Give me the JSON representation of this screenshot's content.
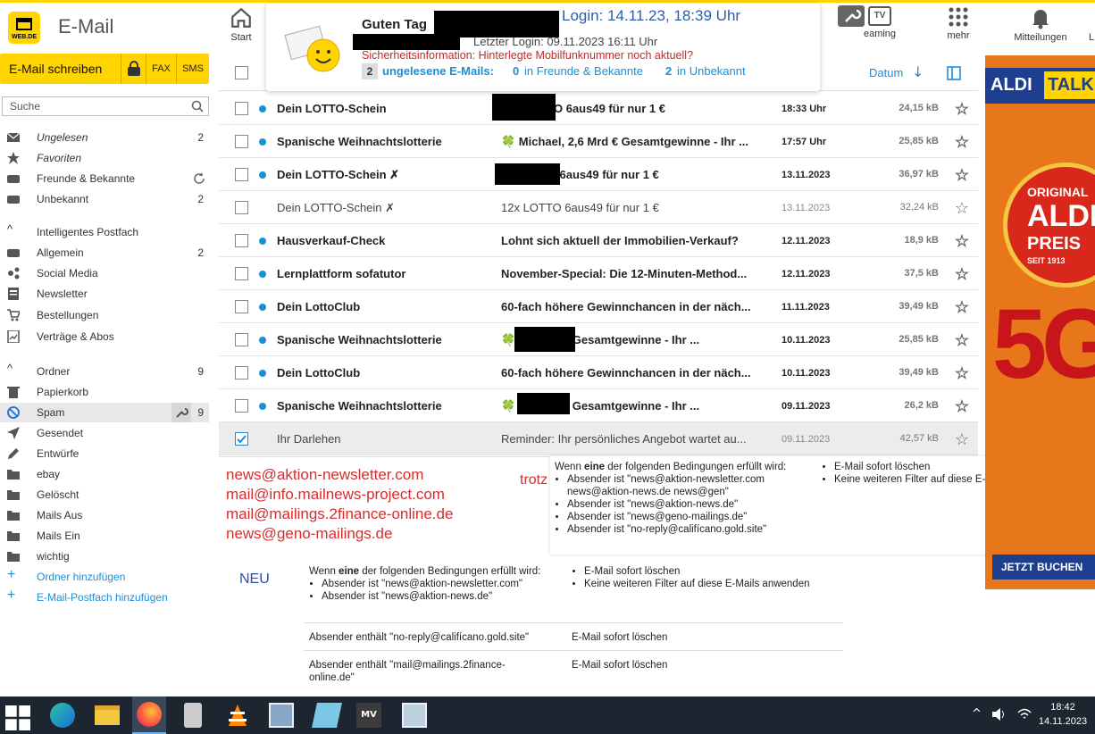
{
  "app": {
    "logo_text": "WEB.DE",
    "title": "E-Mail",
    "top_nav": [
      {
        "label": "Start",
        "icon": "home-icon"
      },
      {
        "label": "eaming",
        "icon": "tv-icon"
      },
      {
        "label": "mehr",
        "icon": "grid-icon"
      },
      {
        "label": "Mitteilungen",
        "icon": "bell-icon"
      },
      {
        "label": "L",
        "icon": "user-icon"
      }
    ],
    "tv_badge": "TV"
  },
  "popup": {
    "greeting": "Guten Tag",
    "login_line": "Login: 14.11.23, 18:39 Uhr",
    "last_login": "Letzter Login: 09.11.2023 16:11 Uhr",
    "security_info": "Sicherheitsinformation: Hinterlegte Mobilfunknummer noch aktuell?",
    "unread_count": "2",
    "unread_label": "ungelesene E-Mails:",
    "friends_count": "0",
    "friends_label": "in Freunde & Bekannte",
    "unknown_count": "2",
    "unknown_label": "in Unbekannt"
  },
  "sidebar": {
    "compose_label": "E-Mail schreiben",
    "fax_label": "FAX",
    "sms_label": "SMS",
    "search_placeholder": "Suche",
    "filters": [
      {
        "label": "Ungelesen",
        "count": "2"
      },
      {
        "label": "Favoriten",
        "count": ""
      },
      {
        "label": "Freunde & Bekannte",
        "count": ""
      },
      {
        "label": "Unbekannt",
        "count": "2"
      }
    ],
    "smart_header": "Intelligentes Postfach",
    "smart": [
      {
        "label": "Allgemein",
        "count": "2"
      },
      {
        "label": "Social Media",
        "count": ""
      },
      {
        "label": "Newsletter",
        "count": ""
      },
      {
        "label": "Bestellungen",
        "count": ""
      },
      {
        "label": "Verträge & Abos",
        "count": ""
      }
    ],
    "folders_header": "Ordner",
    "folders_count": "9",
    "folders": [
      {
        "label": "Papierkorb",
        "count": ""
      },
      {
        "label": "Spam",
        "count": "9"
      },
      {
        "label": "Gesendet",
        "count": ""
      },
      {
        "label": "Entwürfe",
        "count": ""
      },
      {
        "label": "ebay",
        "count": ""
      },
      {
        "label": "Gelöscht",
        "count": ""
      },
      {
        "label": "Mails Aus",
        "count": ""
      },
      {
        "label": "Mails Ein",
        "count": ""
      },
      {
        "label": "wichtig",
        "count": ""
      }
    ],
    "add_folder": "Ordner hinzufügen",
    "add_mailbox": "E-Mail-Postfach hinzufügen"
  },
  "list": {
    "sort_label": "Datum",
    "rows": [
      {
        "sender": "Dein LOTTO-Schein",
        "subject": "12x LOTTO 6aus49 für nur 1 €",
        "date": "18:33 Uhr",
        "size": "24,15 kB",
        "unread": true
      },
      {
        "sender": "Spanische Weihnachtslotterie",
        "subject": "🍀 Michael, 2,6 Mrd € Gesamtgewinne - Ihr ...",
        "date": "17:57 Uhr",
        "size": "25,85 kB",
        "unread": true
      },
      {
        "sender": "Dein LOTTO-Schein ✗",
        "subject": "2x LOTTO 6aus49 für nur 1 €",
        "date": "13.11.2023",
        "size": "36,97 kB",
        "unread": true
      },
      {
        "sender": "Dein LOTTO-Schein ✗",
        "subject": "12x LOTTO 6aus49 für nur 1 €",
        "date": "13.11.2023",
        "size": "32,24 kB",
        "unread": false
      },
      {
        "sender": "Hausverkauf-Check",
        "subject": "Lohnt sich aktuell der Immobilien-Verkauf?",
        "date": "12.11.2023",
        "size": "18,9 kB",
        "unread": true
      },
      {
        "sender": "Lernplattform sofatutor",
        "subject": "November-Special: Die 12-Minuten-Method...",
        "date": "12.11.2023",
        "size": "37,5 kB",
        "unread": true
      },
      {
        "sender": "Dein LottoClub",
        "subject": "60-fach höhere Gewinnchancen in der näch...",
        "date": "11.11.2023",
        "size": "39,49 kB",
        "unread": true
      },
      {
        "sender": "Spanische Weihnachtslotterie",
        "subject": "🍀 2,6 Mrd € Gesamtgewinne - Ihr ...",
        "date": "10.11.2023",
        "size": "25,85 kB",
        "unread": true
      },
      {
        "sender": "Dein LottoClub",
        "subject": "60-fach höhere Gewinnchancen in der näch...",
        "date": "10.11.2023",
        "size": "39,49 kB",
        "unread": true
      },
      {
        "sender": "Spanische Weihnachtslotterie",
        "subject": "🍀 2,6 Mrd € Gesamtgewinne - Ihr ...",
        "date": "09.11.2023",
        "size": "26,2 kB",
        "unread": true
      },
      {
        "sender": "Ihr Darlehen",
        "subject": "Reminder: Ihr persönliches Angebot wartet au...",
        "date": "09.11.2023",
        "size": "42,57 kB",
        "unread": false,
        "checked": true
      }
    ]
  },
  "notes": {
    "red_emails": [
      "news@aktion-newsletter.com",
      "mail@info.mailnews-project.com",
      "mail@mailings.2finance-online.de",
      "news@geno-mailings.de"
    ],
    "trotz": "trotz",
    "neu": "NEU",
    "rule1": {
      "condition_prefix": "Wenn",
      "condition_bold": "eine",
      "condition_suffix": "der folgenden Bedingungen erfüllt wird:",
      "bullets": [
        "Absender ist \"news@aktion-newsletter.com news@aktion-news.de news@gen\"",
        "Absender ist \"news@aktion-news.de\"",
        "Absender ist \"news@geno-mailings.de\"",
        "Absender ist \"no-reply@califícano.gold.site\""
      ],
      "actions": [
        "E-Mail sofort löschen",
        "Keine weiteren Filter auf diese E-Mails anwenden"
      ]
    },
    "rule2": {
      "condition_prefix": "Wenn",
      "condition_bold": "eine",
      "condition_suffix": "der folgenden Bedingungen erfüllt wird:",
      "bullets": [
        "Absender ist \"news@aktion-newsletter.com\"",
        "Absender ist \"news@aktion-news.de\""
      ],
      "actions": [
        "E-Mail sofort löschen",
        "Keine weiteren Filter auf diese E-Mails anwenden"
      ]
    },
    "rule3": {
      "condition": "Absender enthält \"no-reply@califícano.gold.site\"",
      "action": "E-Mail sofort löschen"
    },
    "rule4": {
      "condition": "Absender enthält \"mail@mailings.2finance-online.de\"",
      "action": "E-Mail sofort löschen"
    }
  },
  "ad": {
    "brand_left": "ALDI",
    "brand_right": "TALK",
    "badge_top": "ORIGINAL",
    "badge_mid": "ALDI",
    "badge_bot": "PREIS",
    "badge_since": "SEIT 1913",
    "big": "5G",
    "cta": "JETZT BUCHEN"
  },
  "taskbar": {
    "time": "18:42",
    "date": "14.11.2023"
  }
}
